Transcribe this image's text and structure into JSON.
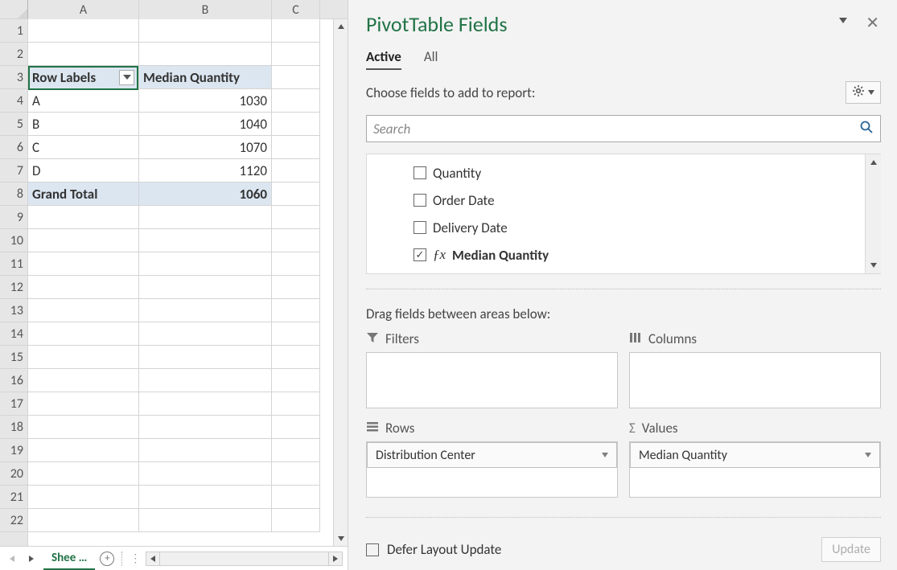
{
  "sheet": {
    "tab_label": "Shee …",
    "columns": [
      "A",
      "B",
      "C"
    ],
    "row_count": 22,
    "header": {
      "A": "Row Labels",
      "B": "Median Quantity"
    },
    "rows": [
      {
        "A": "A",
        "B": "1030"
      },
      {
        "A": "B",
        "B": "1040"
      },
      {
        "A": "C",
        "B": "1070"
      },
      {
        "A": "D",
        "B": "1120"
      }
    ],
    "grand_total": {
      "label": "Grand Total",
      "value": "1060"
    }
  },
  "pivot": {
    "title": "PivotTable Fields",
    "tabs": {
      "active": "Active",
      "all": "All"
    },
    "choose_label": "Choose fields to add to report:",
    "search_placeholder": "Search",
    "field_list": [
      {
        "label": "Quantity",
        "checked": false,
        "fx": false
      },
      {
        "label": "Order Date",
        "checked": false,
        "fx": false
      },
      {
        "label": "Delivery Date",
        "checked": false,
        "fx": false
      },
      {
        "label": "Median Quantity",
        "checked": true,
        "fx": true
      }
    ],
    "drag_label": "Drag fields between areas below:",
    "areas": {
      "filters": {
        "title": "Filters",
        "items": []
      },
      "columns": {
        "title": "Columns",
        "items": []
      },
      "rows": {
        "title": "Rows",
        "items": [
          "Distribution Center"
        ]
      },
      "values": {
        "title": "Values",
        "items": [
          "Median Quantity"
        ]
      }
    },
    "defer_label": "Defer Layout Update",
    "update_label": "Update"
  }
}
